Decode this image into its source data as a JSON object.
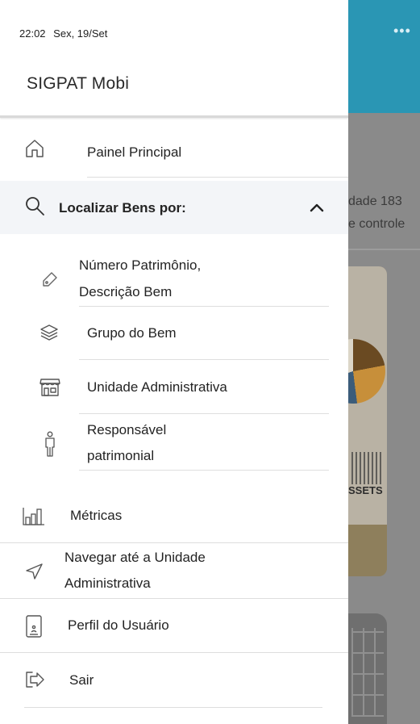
{
  "status_bar": {
    "time": "22:02",
    "date": "Sex, 19/Set"
  },
  "app": {
    "title": "SIGPAT Mobi"
  },
  "menu": {
    "painel": {
      "label": "Painel Principal",
      "icon": "home-icon"
    },
    "localizar": {
      "label": "Localizar Bens por:",
      "icon": "search-icon",
      "expanded": true
    },
    "sub": [
      {
        "line1": "Número Patrimônio,",
        "line2": "Descrição Bem",
        "icon": "tag-icon"
      },
      {
        "line1": "Grupo do Bem",
        "line2": "",
        "icon": "layers-icon"
      },
      {
        "line1": "Unidade Administrativa",
        "line2": "",
        "icon": "store-icon"
      },
      {
        "line1": "Responsável",
        "line2": "patrimonial",
        "icon": "person-icon"
      }
    ],
    "metricas": {
      "label": "Métricas",
      "icon": "bar-chart-icon"
    },
    "navegar": {
      "line1": "Navegar até a Unidade",
      "line2": "Administrativa",
      "icon": "navigation-icon"
    },
    "perfil": {
      "label": "Perfil do Usuário",
      "icon": "phone-user-icon"
    },
    "sair": {
      "label": "Sair",
      "icon": "logout-icon"
    }
  },
  "background_app": {
    "text_line1": "dade 183",
    "text_line2": "e controle",
    "card_word": "SSETS",
    "header_color": "#2a96b4",
    "menu_dots": "•••"
  }
}
